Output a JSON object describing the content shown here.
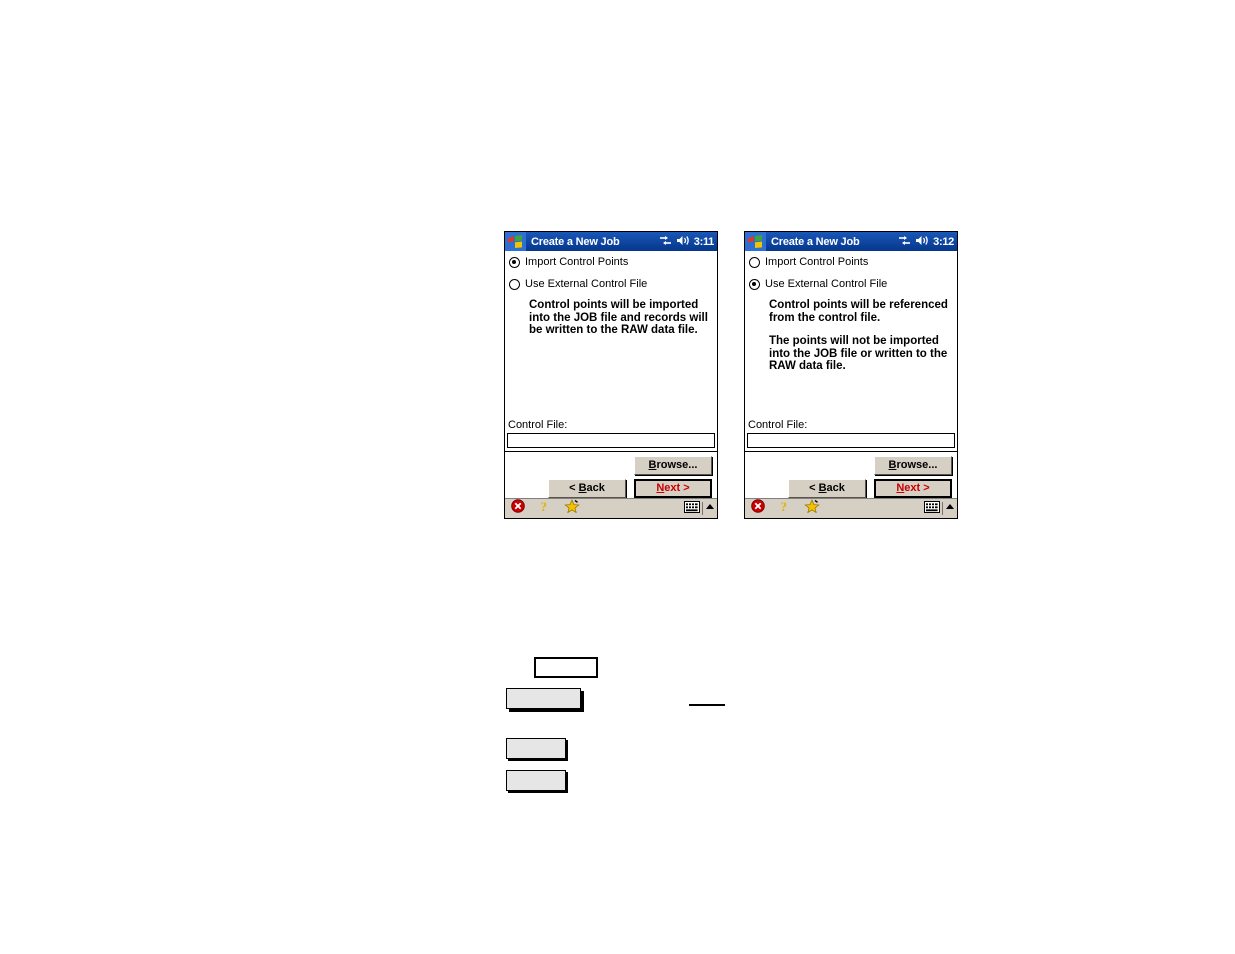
{
  "panels": [
    {
      "id": "left",
      "titlebar": {
        "logo_icon": "windows-flag-icon",
        "title": "Create a New Job",
        "connectivity_icon": "connectivity-icon",
        "volume_icon": "speaker-icon",
        "clock": "3:11"
      },
      "options": [
        {
          "label": "Import Control Points",
          "selected": true
        },
        {
          "label": "Use External Control File",
          "selected": false
        }
      ],
      "description": [
        "Control points will be imported into the JOB file and records will be written to the RAW data file."
      ],
      "control_file": {
        "label": "Control File:",
        "value": "",
        "placeholder": ""
      },
      "buttons": {
        "browse": "Browse...",
        "back": "< Back",
        "next": "Next >"
      },
      "taskbar": {
        "close_icon": "close-circle-icon",
        "help_icon": "help-question-icon",
        "favorites_icon": "star-icon",
        "keyboard_icon": "keyboard-icon",
        "expand_icon": "chevron-up-icon"
      }
    },
    {
      "id": "right",
      "titlebar": {
        "logo_icon": "windows-flag-icon",
        "title": "Create a New Job",
        "connectivity_icon": "connectivity-icon",
        "volume_icon": "speaker-icon",
        "clock": "3:12"
      },
      "options": [
        {
          "label": "Import Control Points",
          "selected": false
        },
        {
          "label": "Use External Control File",
          "selected": true
        }
      ],
      "description": [
        "Control points will be referenced from the control file.",
        "The points will not be imported into the JOB file or written to the RAW data file."
      ],
      "control_file": {
        "label": "Control File:",
        "value": "",
        "placeholder": ""
      },
      "buttons": {
        "browse": "Browse...",
        "back": "< Back",
        "next": "Next >"
      },
      "taskbar": {
        "close_icon": "close-circle-icon",
        "help_icon": "help-question-icon",
        "favorites_icon": "star-icon",
        "keyboard_icon": "keyboard-icon",
        "expand_icon": "chevron-up-icon"
      }
    }
  ],
  "colors": {
    "titlebar": "#08429c",
    "taskbar": "#d6cfc4",
    "button_face": "#d6cfc4",
    "next_text": "#cc0000",
    "close_icon": "#cc0000",
    "star_icon": "#f2c200"
  },
  "artifacts": {
    "box_1": "",
    "box_2": "",
    "box_3": "",
    "box_4": "",
    "rule": ""
  }
}
